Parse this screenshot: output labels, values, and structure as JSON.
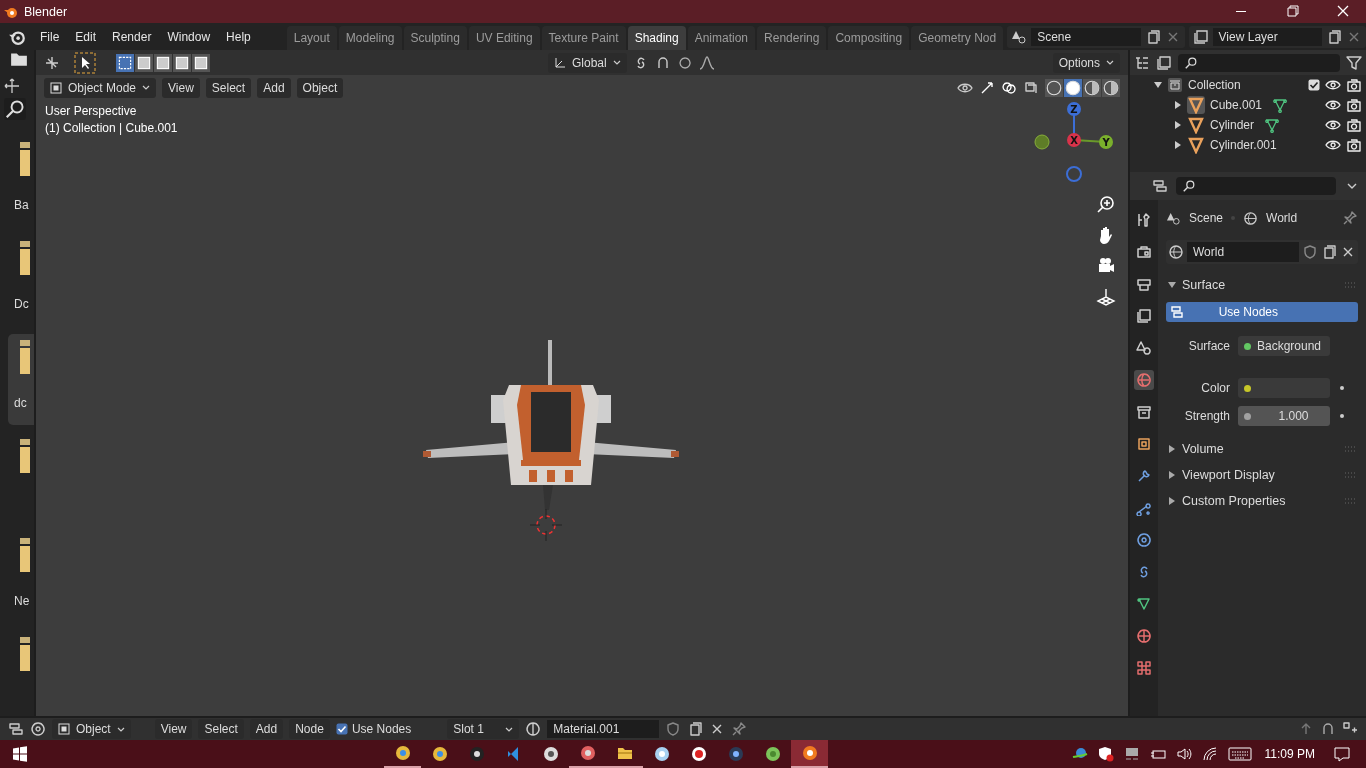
{
  "window": {
    "title": "Blender"
  },
  "menus": [
    "File",
    "Edit",
    "Render",
    "Window",
    "Help"
  ],
  "workspaces": [
    {
      "label": "Layout",
      "selected": false
    },
    {
      "label": "Modeling",
      "selected": false
    },
    {
      "label": "Sculpting",
      "selected": false
    },
    {
      "label": "UV Editing",
      "selected": false
    },
    {
      "label": "Texture Paint",
      "selected": false
    },
    {
      "label": "Shading",
      "selected": true
    },
    {
      "label": "Animation",
      "selected": false
    },
    {
      "label": "Rendering",
      "selected": false
    },
    {
      "label": "Compositing",
      "selected": false
    },
    {
      "label": "Geometry Nod",
      "selected": false
    }
  ],
  "scene": {
    "value": "Scene"
  },
  "view_layer": {
    "value": "View Layer"
  },
  "tool_header": {
    "orientation": "Global",
    "options": "Options"
  },
  "asset_strip": {
    "items": [
      {
        "label": "Ba",
        "selected": false
      },
      {
        "label": "Dc",
        "selected": false
      },
      {
        "label": "dc",
        "selected": true
      },
      {
        "selected": false
      },
      {
        "label": "Ne",
        "selected": false
      },
      {
        "selected": false
      }
    ]
  },
  "viewport": {
    "mode": "Object Mode",
    "menus": [
      "View",
      "Select",
      "Add",
      "Object"
    ],
    "overlay": [
      "User Perspective",
      "(1) Collection | Cube.001"
    ],
    "gizmo": {
      "z": "Z",
      "x": "X",
      "y": "Y"
    },
    "shading": [
      {
        "selected": false
      },
      {
        "selected": true
      },
      {
        "selected": false
      },
      {
        "selected": false
      }
    ]
  },
  "outliner": {
    "items": [
      {
        "label": "Collection",
        "checked": true,
        "expanded": true,
        "children": [
          {
            "label": "Cube.001",
            "selected": true,
            "mesh_data": true
          },
          {
            "label": "Cylinder",
            "selected": false,
            "mesh_data": true
          },
          {
            "label": "Cylinder.001",
            "selected": false,
            "mesh_data": false
          }
        ]
      }
    ]
  },
  "properties": {
    "tabs": [
      {
        "kind": "tool",
        "selected": false
      },
      {
        "kind": "render",
        "selected": false
      },
      {
        "kind": "output",
        "selected": false
      },
      {
        "kind": "view_layer",
        "selected": false
      },
      {
        "kind": "scene",
        "selected": false
      },
      {
        "kind": "world",
        "selected": true
      },
      {
        "kind": "collection",
        "selected": false
      },
      {
        "kind": "object",
        "selected": false
      },
      {
        "kind": "modifier",
        "selected": false
      },
      {
        "kind": "particles",
        "selected": false
      },
      {
        "kind": "physics",
        "selected": false
      },
      {
        "kind": "constraints",
        "selected": false
      },
      {
        "kind": "data",
        "selected": false
      },
      {
        "kind": "material",
        "selected": false
      },
      {
        "kind": "texture",
        "selected": false
      }
    ],
    "breadcrumb": [
      "Scene",
      "World"
    ],
    "datablock": "World",
    "panels": [
      {
        "title": "Surface",
        "expanded": true,
        "use_nodes": "Use Nodes",
        "fields": [
          {
            "kind": "shader",
            "label": "Surface",
            "value": "Background"
          },
          {
            "kind": "color",
            "label": "Color"
          },
          {
            "kind": "number",
            "label": "Strength",
            "value": "1.000"
          }
        ]
      },
      {
        "title": "Volume",
        "expanded": false
      },
      {
        "title": "Viewport Display",
        "expanded": false
      },
      {
        "title": "Custom Properties",
        "expanded": false
      }
    ]
  },
  "node_header": {
    "mode": "Object",
    "menus": [
      "View",
      "Select",
      "Add",
      "Node"
    ],
    "use_nodes": {
      "label": "Use Nodes",
      "checked": true
    },
    "slot": "Slot 1",
    "material": "Material.001"
  },
  "taskbar": {
    "apps": [
      {
        "kind": "chrome",
        "running": true,
        "selected": false
      },
      {
        "kind": "chrome",
        "running": false,
        "selected": false
      },
      {
        "kind": "terminal",
        "running": false,
        "selected": false
      },
      {
        "kind": "code",
        "running": false,
        "selected": false
      },
      {
        "kind": "cube",
        "running": false,
        "selected": false
      },
      {
        "kind": "paint",
        "running": true,
        "selected": false
      },
      {
        "kind": "folder",
        "running": true,
        "selected": false
      },
      {
        "kind": "notepad",
        "running": false,
        "selected": false
      },
      {
        "kind": "record",
        "running": false,
        "selected": false
      },
      {
        "kind": "shell",
        "running": false,
        "selected": false
      },
      {
        "kind": "block",
        "running": false,
        "selected": false
      },
      {
        "kind": "blender",
        "running": true,
        "selected": true
      }
    ],
    "time": "11:09 PM"
  }
}
